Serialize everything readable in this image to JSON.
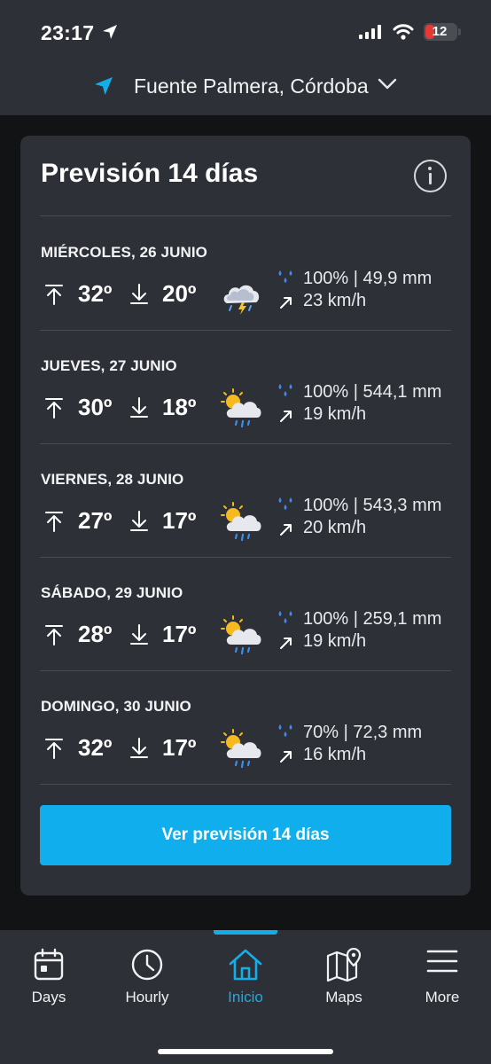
{
  "status_bar": {
    "time": "23:17",
    "battery": "12"
  },
  "location": {
    "name": "Fuente Palmera, Córdoba"
  },
  "forecast": {
    "title": "Previsión 14 días",
    "days": [
      {
        "date": "MIÉRCOLES, 26 JUNIO",
        "max": "32º",
        "min": "20º",
        "icon": "storm-cloud-icon",
        "rain": "100% | 49,9 mm",
        "wind": "23 km/h"
      },
      {
        "date": "JUEVES, 27 JUNIO",
        "max": "30º",
        "min": "18º",
        "icon": "sun-cloud-rain-icon",
        "rain": "100% | 544,1 mm",
        "wind": "19 km/h"
      },
      {
        "date": "VIERNES, 28 JUNIO",
        "max": "27º",
        "min": "17º",
        "icon": "sun-cloud-rain-icon",
        "rain": "100% | 543,3 mm",
        "wind": "20 km/h"
      },
      {
        "date": "SÁBADO, 29 JUNIO",
        "max": "28º",
        "min": "17º",
        "icon": "sun-cloud-rain-icon",
        "rain": "100% | 259,1 mm",
        "wind": "19 km/h"
      },
      {
        "date": "DOMINGO, 30 JUNIO",
        "max": "32º",
        "min": "17º",
        "icon": "sun-cloud-rain-icon",
        "rain": "70% | 72,3 mm",
        "wind": "16 km/h"
      }
    ],
    "button_label": "Ver previsión 14 días"
  },
  "nav": {
    "items": [
      {
        "label": "Days",
        "icon": "calendar-icon"
      },
      {
        "label": "Hourly",
        "icon": "clock-icon"
      },
      {
        "label": "Inicio",
        "icon": "home-icon",
        "active": true
      },
      {
        "label": "Maps",
        "icon": "map-pin-icon"
      },
      {
        "label": "More",
        "icon": "menu-icon"
      }
    ]
  },
  "colors": {
    "accent": "#10aeed",
    "background": "#121314",
    "card": "#2d3036",
    "battery_low": "#e53935"
  }
}
